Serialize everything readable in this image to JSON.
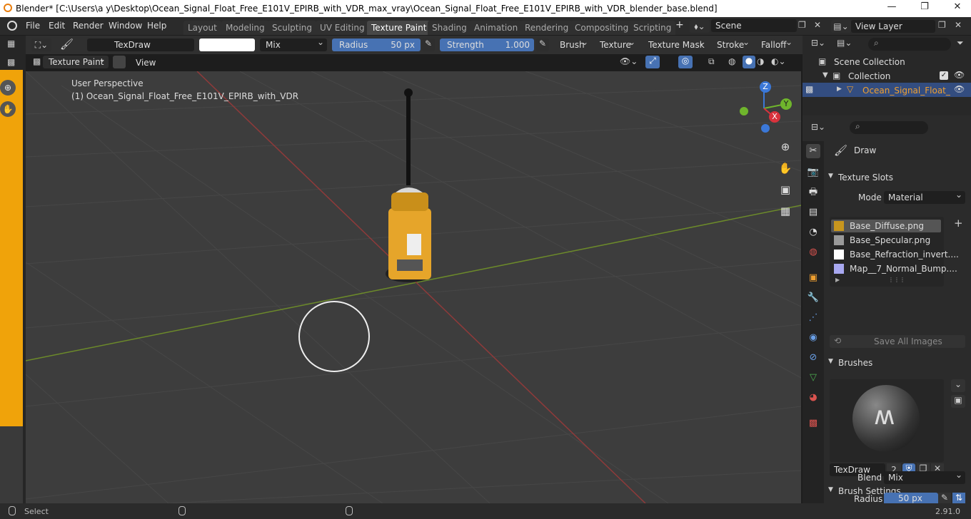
{
  "titlebar": {
    "title": "Blender* [C:\\Users\\a y\\Desktop\\Ocean_Signal_Float_Free_E101V_EPIRB_with_VDR_max_vray\\Ocean_Signal_Float_Free_E101V_EPIRB_with_VDR_blender_base.blend]",
    "min": "—",
    "max": "❐",
    "close": "✕"
  },
  "menu": [
    "File",
    "Edit",
    "Render",
    "Window",
    "Help"
  ],
  "workspaces": [
    "Layout",
    "Modeling",
    "Sculpting",
    "UV Editing",
    "Texture Paint",
    "Shading",
    "Animation",
    "Rendering",
    "Compositing",
    "Scripting"
  ],
  "add_tab": "+",
  "scene": "Scene",
  "view_layer": "View Layer",
  "toolheader": {
    "brush_name": "TexDraw",
    "blend": "Mix",
    "radius_label": "Radius",
    "radius_value": "50 px",
    "strength_label": "Strength",
    "strength_value": "1.000",
    "strength_fill": 1.0,
    "brush": "Brush",
    "texture": "Texture",
    "texture_mask": "Texture Mask",
    "stroke": "Stroke",
    "falloff": "Falloff"
  },
  "viewheader": {
    "mode": "Texture Paint",
    "view": "View"
  },
  "viewport": {
    "perspective": "User Perspective",
    "object": "(1) Ocean_Signal_Float_Free_E101V_EPIRB_with_VDR",
    "gizmo": {
      "z": "Z",
      "y": "Y",
      "x": "X"
    }
  },
  "outliner": {
    "scene_collection": "Scene Collection",
    "collection": "Collection",
    "object": "Ocean_Signal_Float_"
  },
  "props": {
    "tool": "Draw",
    "texture_slots": "Texture Slots",
    "mode_label": "Mode",
    "mode_value": "Material",
    "slots": [
      "Base_Diffuse.png",
      "Base_Specular.png",
      "Base_Refraction_invert....",
      "Map__7_Normal_Bump...."
    ],
    "save_all": "Save All Images",
    "brushes": "Brushes",
    "brush_name": "TexDraw",
    "brush_users": "2",
    "brush_settings": "Brush Settings",
    "blend_label": "Blend",
    "blend_value": "Mix",
    "radius_label": "Radius",
    "radius_value": "50 px"
  },
  "status": {
    "select": "Select",
    "version": "2.91.0"
  }
}
